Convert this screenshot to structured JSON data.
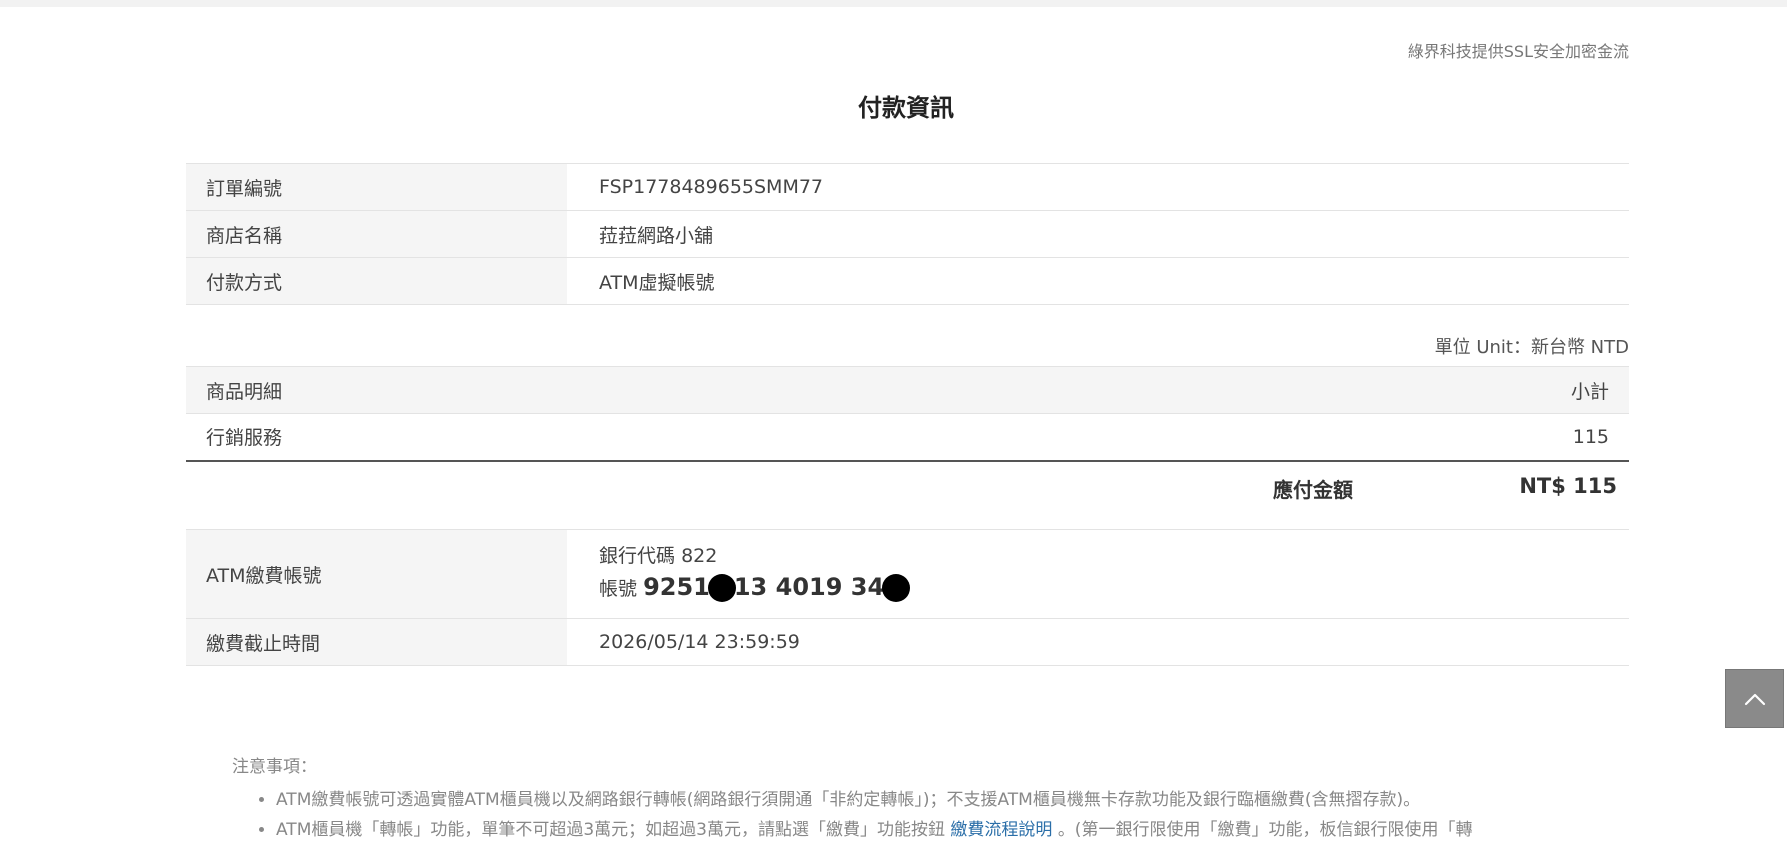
{
  "header": {
    "ssl_note": "綠界科技提供SSL安全加密金流",
    "title": "付款資訊"
  },
  "order": {
    "rows": [
      {
        "label": "訂單編號",
        "value": "FSP1778489655SMM77"
      },
      {
        "label": "商店名稱",
        "value": "菈菈網路小舖"
      },
      {
        "label": "付款方式",
        "value": "ATM虛擬帳號"
      }
    ]
  },
  "items": {
    "unit_note": "單位 Unit：新台幣 NTD",
    "header_item": "商品明細",
    "header_subtotal": "小計",
    "rows": [
      {
        "name": "行銷服務",
        "subtotal": "115"
      }
    ],
    "total_label": "應付金額",
    "total_value": "NT$ 115"
  },
  "atm": {
    "account_label": "ATM繳費帳號",
    "bank_code_prefix": "銀行代碼",
    "bank_code": "822",
    "account_prefix": "帳號",
    "account_part1": "9251",
    "account_part2": "13 4019 34",
    "deadline_label": "繳費截止時間",
    "deadline_value": "2026/05/14 23:59:59",
    "deadline_color": "#d0446a"
  },
  "notes": {
    "title": "注意事項：",
    "item1": "ATM繳費帳號可透過實體ATM櫃員機以及網路銀行轉帳(網路銀行須開通「非約定轉帳」)；不支援ATM櫃員機無卡存款功能及銀行臨櫃繳費(含無摺存款)。",
    "item2_before": "ATM櫃員機「轉帳」功能，單筆不可超過3萬元；如超過3萬元，請點選「繳費」功能按鈕",
    "item2_link": "繳費流程說明",
    "item2_after": "。(第一銀行限使用「繳費」功能，板信銀行限使用「轉"
  },
  "controls": {
    "back_to_top_icon": "chevron-up-icon"
  }
}
